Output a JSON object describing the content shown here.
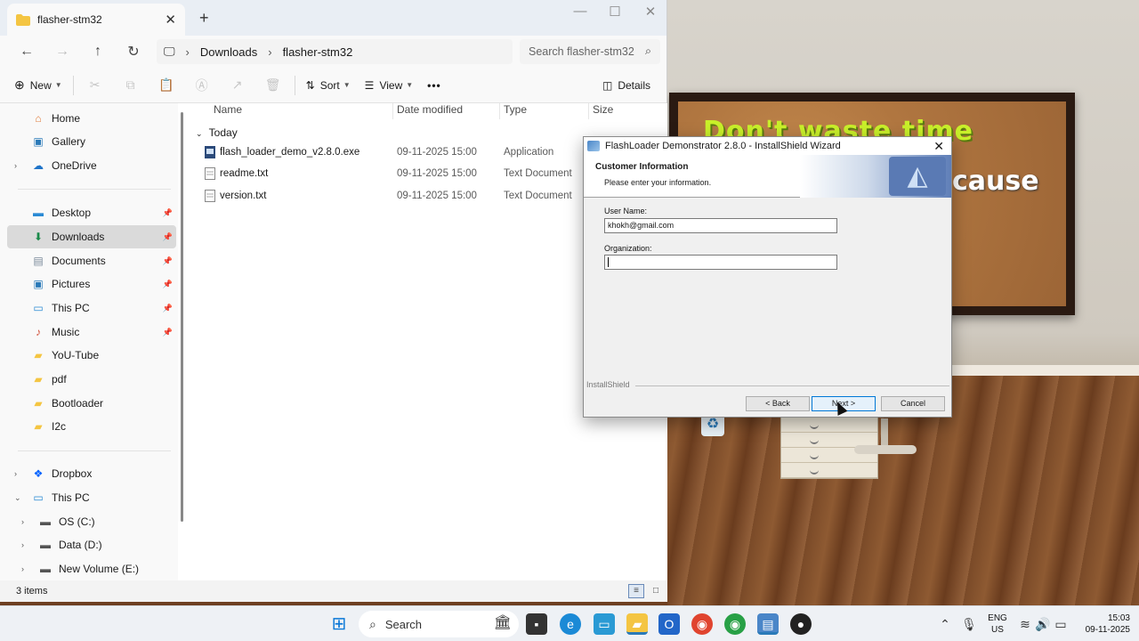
{
  "explorer": {
    "tab_title": "flasher-stm32",
    "breadcrumb": [
      "Downloads",
      "flasher-stm32"
    ],
    "search_placeholder": "Search flasher-stm32",
    "commands": {
      "new": "New",
      "sort": "Sort",
      "view": "View",
      "more": "•••",
      "details": "Details"
    },
    "nav": {
      "quick": [
        {
          "label": "Home",
          "icon": "home-icon"
        },
        {
          "label": "Gallery",
          "icon": "gallery-icon"
        },
        {
          "label": "OneDrive",
          "icon": "cloud-icon"
        }
      ],
      "pinned": [
        {
          "label": "Desktop",
          "icon": "desktop-icon"
        },
        {
          "label": "Downloads",
          "icon": "download-icon"
        },
        {
          "label": "Documents",
          "icon": "document-icon"
        },
        {
          "label": "Pictures",
          "icon": "pictures-icon"
        },
        {
          "label": "This PC",
          "icon": "pc-icon"
        },
        {
          "label": "Music",
          "icon": "music-icon"
        },
        {
          "label": "YoU-Tube",
          "icon": "folder-icon"
        },
        {
          "label": "pdf",
          "icon": "folder-icon"
        },
        {
          "label": "Bootloader",
          "icon": "folder-icon"
        },
        {
          "label": "I2c",
          "icon": "folder-icon"
        }
      ],
      "bottom": [
        {
          "label": "Dropbox",
          "icon": "dropbox-icon"
        },
        {
          "label": "This PC",
          "icon": "pc-icon"
        },
        {
          "label": "OS (C:)",
          "icon": "drive-icon"
        },
        {
          "label": "Data (D:)",
          "icon": "drive-icon"
        },
        {
          "label": "New Volume (E:)",
          "icon": "drive-icon"
        }
      ]
    },
    "columns": {
      "name": "Name",
      "date": "Date modified",
      "type": "Type",
      "size": "Size"
    },
    "group": "Today",
    "files": [
      {
        "name": "flash_loader_demo_v2.8.0.exe",
        "date": "09-11-2025 15:00",
        "type": "Application",
        "icon": "exe-icon"
      },
      {
        "name": "readme.txt",
        "date": "09-11-2025 15:00",
        "type": "Text Document",
        "icon": "text-file-icon"
      },
      {
        "name": "version.txt",
        "date": "09-11-2025 15:00",
        "type": "Text Document",
        "icon": "text-file-icon"
      }
    ],
    "status": "3 items"
  },
  "dialog": {
    "title": "FlashLoader Demonstrator 2.8.0 - InstallShield Wizard",
    "heading": "Customer Information",
    "subheading": "Please enter your information.",
    "user_name_label": "User Name:",
    "user_name_value": "khokh@gmail.com",
    "org_label": "Organization:",
    "org_value": "",
    "footer_brand": "InstallShield",
    "back": "< Back",
    "next": "Next >",
    "cancel": "Cancel"
  },
  "wallpaper": {
    "text1": "Don't waste time",
    "text2": "cause"
  },
  "taskbar": {
    "search": "Search",
    "lang_top": "ENG",
    "lang_bottom": "US",
    "time": "15:03",
    "date": "09-11-2025"
  },
  "colors": {
    "accent": "#0078d7",
    "selected_nav": "#dadada",
    "folder": "#f4c542"
  }
}
